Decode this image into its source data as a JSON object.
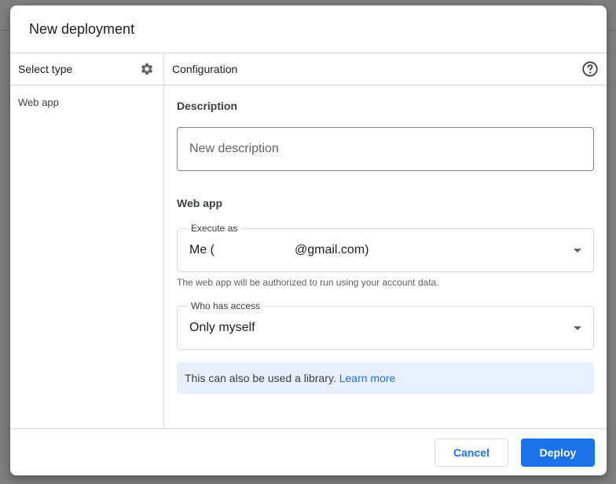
{
  "dialog": {
    "title": "New deployment"
  },
  "select_type": {
    "header_label": "Select type",
    "settings_icon": "gear-icon",
    "items": [
      {
        "label": "Web app"
      }
    ]
  },
  "configuration": {
    "header_label": "Configuration",
    "help_icon": "help-circle-icon",
    "description": {
      "label": "Description",
      "placeholder": "New description",
      "value": ""
    },
    "web_app": {
      "section_label": "Web app",
      "execute_as": {
        "label": "Execute as",
        "value_prefix": "Me (",
        "value_suffix": "@gmail.com)",
        "helper": "The web app will be authorized to run using your account data."
      },
      "who_has_access": {
        "label": "Who has access",
        "value": "Only myself"
      }
    },
    "info": {
      "text": "This can also be used a library.",
      "link": "Learn more"
    }
  },
  "footer": {
    "cancel_label": "Cancel",
    "deploy_label": "Deploy"
  },
  "colors": {
    "accent": "#1a73e8",
    "info_background": "#e8f0fe",
    "divider": "#dadce0",
    "backdrop": "#7f7f7f"
  }
}
